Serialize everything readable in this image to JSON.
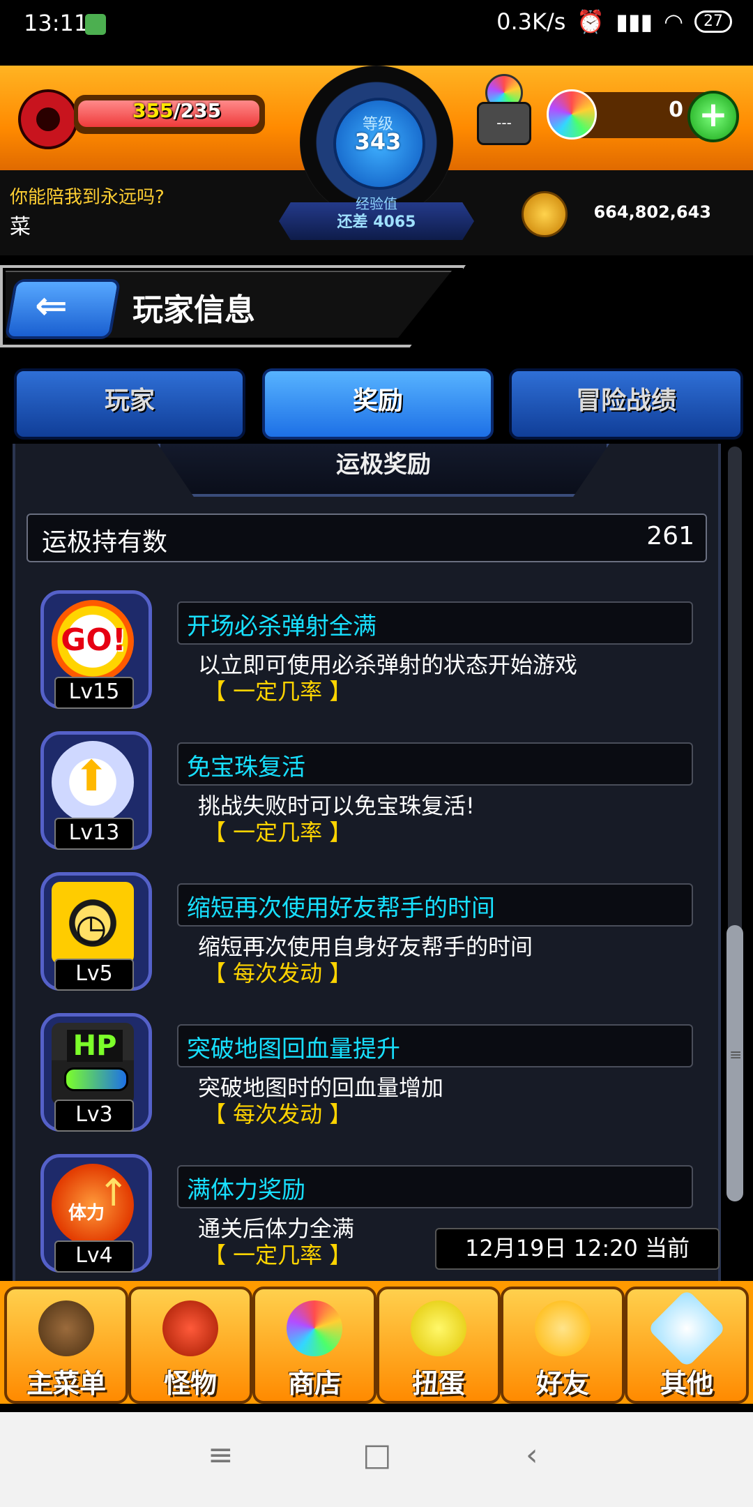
{
  "status_bar": {
    "time": "13:11",
    "network_speed": "0.3K/s",
    "battery": "27",
    "icons": [
      "app-notification-icon",
      "alarm-icon",
      "hd-signal-icon",
      "wifi-icon",
      "battery-icon"
    ]
  },
  "header": {
    "hp_current": "355",
    "hp_max": "/235",
    "level_label": "等级",
    "level_value": "343",
    "exp_label": "经验值",
    "exp_remaining": "还差 4065",
    "orb_count": "0",
    "lock_label": "---",
    "player_title": "你能陪我到永远吗?",
    "player_name": "菜",
    "coins": "664,802,643"
  },
  "page": {
    "title": "玩家信息",
    "tabs": [
      {
        "label": "玩家",
        "active": false
      },
      {
        "label": "奖励",
        "active": true
      },
      {
        "label": "冒险战绩",
        "active": false
      }
    ]
  },
  "rewards_section": {
    "header": "运极奖励",
    "count_label": "运极持有数",
    "count_value": "261",
    "items": [
      {
        "icon": "go-burst-icon",
        "level": "Lv15",
        "title": "开场必杀弹射全满",
        "desc": "以立即可使用必杀弹射的状态开始游戏",
        "rate": "【 一定几率 】"
      },
      {
        "icon": "winged-arrow-icon",
        "level": "Lv13",
        "title": "免宝珠复活",
        "desc": "挑战失败时可以免宝珠复活!",
        "rate": "【 一定几率 】"
      },
      {
        "icon": "friend-timer-icon",
        "level": "Lv5",
        "title": "缩短再次使用好友帮手的时间",
        "desc": "缩短再次使用自身好友帮手的时间",
        "rate": "【 每次发动 】"
      },
      {
        "icon": "hp-bar-icon",
        "level": "Lv3",
        "title": "突破地图回血量提升",
        "desc": "突破地图时的回血量增加",
        "rate": "【 每次发动 】"
      },
      {
        "icon": "stamina-icon",
        "level": "Lv4",
        "title": "满体力奖励",
        "desc": "通关后体力全满",
        "rate": "【 一定几率 】"
      }
    ],
    "timestamp": "12月19日 12:20 当前"
  },
  "bottom_nav": [
    {
      "label": "主菜单",
      "icon": "gate-icon"
    },
    {
      "label": "怪物",
      "icon": "dragon-icon"
    },
    {
      "label": "商店",
      "icon": "rainbow-orb-icon"
    },
    {
      "label": "扭蛋",
      "icon": "egg-icon"
    },
    {
      "label": "好友",
      "icon": "friends-icon"
    },
    {
      "label": "其他",
      "icon": "question-icon"
    }
  ],
  "system_nav": {
    "menu_icon": "≡",
    "home_icon": "□",
    "back_icon": "‹"
  },
  "colors": {
    "header_orange": "#ff9a00",
    "tab_blue": "#1d70e6",
    "reward_title_cyan": "#18e0ff",
    "rate_yellow": "#ffd400"
  }
}
